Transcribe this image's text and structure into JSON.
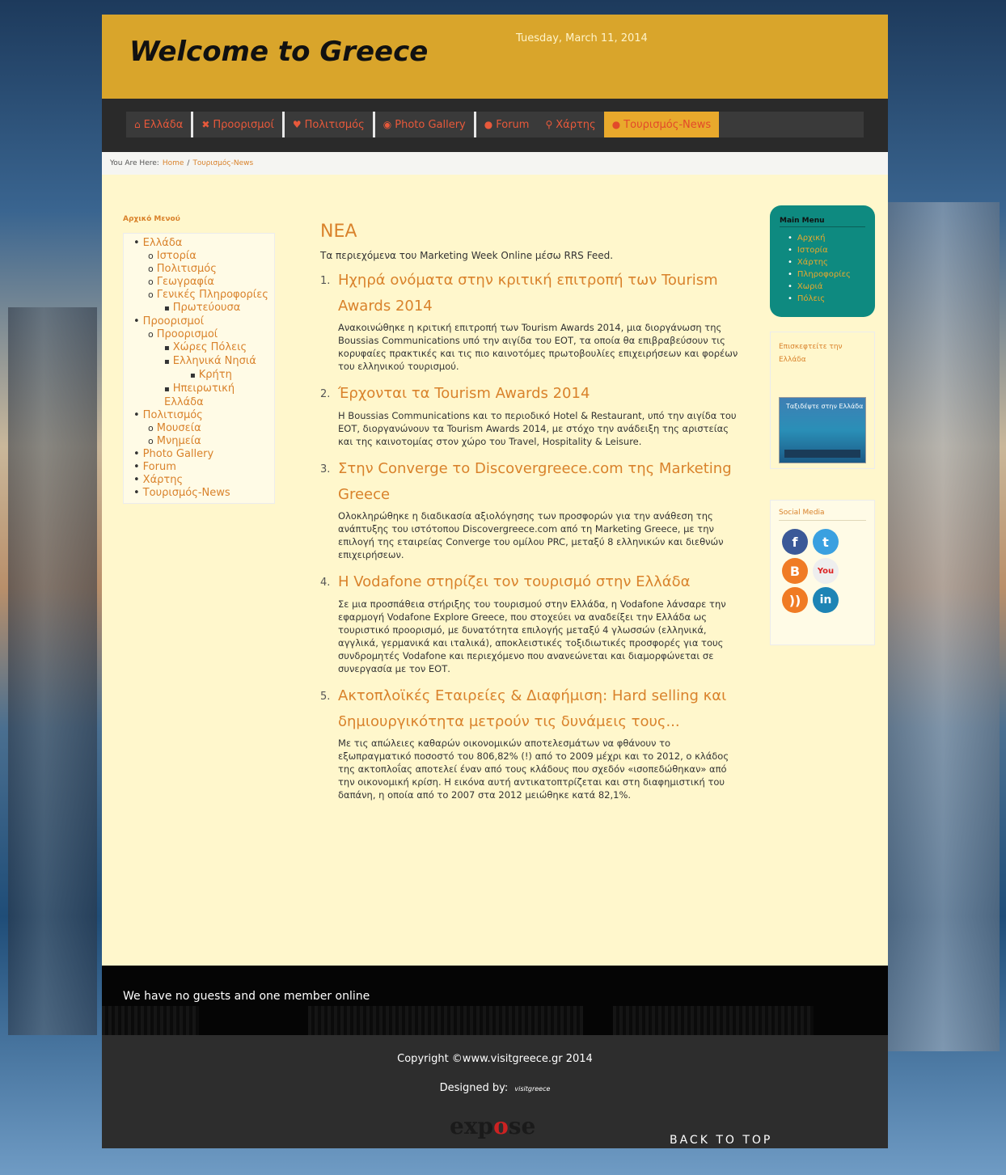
{
  "header": {
    "title": "Welcome to Greece",
    "date": "Tuesday, March 11, 2014"
  },
  "nav": {
    "items": [
      {
        "icon": "home-icon",
        "glyph": "⌂",
        "label": "Ελλάδα"
      },
      {
        "icon": "cross-icon",
        "glyph": "✖",
        "label": "Προορισμοί"
      },
      {
        "icon": "heart-icon",
        "glyph": "♥",
        "label": "Πολιτισμός"
      },
      {
        "icon": "camera-icon",
        "glyph": "◉",
        "label": "Photo Gallery"
      },
      {
        "icon": "comment-icon",
        "glyph": "●",
        "label": "Forum"
      },
      {
        "icon": "map-marker-icon",
        "glyph": "⚲",
        "label": "Χάρτης"
      },
      {
        "icon": "globe-icon",
        "glyph": "●",
        "label": "Τουρισμός-News"
      }
    ]
  },
  "breadcrumb": {
    "prefix": "You Are Here:",
    "home": "Home",
    "current": "Τουρισμός-News"
  },
  "left_menu": {
    "title": "Αρχικό Μενού",
    "items": [
      {
        "label": "Ελλάδα",
        "level": 0
      },
      {
        "label": "Ιστορία",
        "level": 1
      },
      {
        "label": "Πολιτισμός",
        "level": 1
      },
      {
        "label": "Γεωγραφία",
        "level": 1
      },
      {
        "label": "Γενικές Πληροφορίες",
        "level": 1
      },
      {
        "label": "Πρωτεύουσα",
        "level": 2
      },
      {
        "label": "Προορισμοί",
        "level": 0
      },
      {
        "label": "Προορισμοί",
        "level": 1
      },
      {
        "label": "Χώρες Πόλεις",
        "level": 2
      },
      {
        "label": "Ελληνικά Νησιά",
        "level": 2
      },
      {
        "label": "Κρήτη",
        "level": 3
      },
      {
        "label": "Ηπειρωτική Ελλάδα",
        "level": 2
      },
      {
        "label": "Πολιτισμός",
        "level": 0
      },
      {
        "label": "Μουσεία",
        "level": 1
      },
      {
        "label": "Μνημεία",
        "level": 1
      },
      {
        "label": "Photo Gallery",
        "level": 0
      },
      {
        "label": "Forum",
        "level": 0
      },
      {
        "label": "Χάρτης",
        "level": 0
      },
      {
        "label": "Τουρισμός-News",
        "level": 0
      }
    ]
  },
  "main": {
    "heading": "ΝΕΑ",
    "intro": "Τα περιεχόμενα του Marketing Week Online μέσω RRS Feed.",
    "news": [
      {
        "num": "1.",
        "title": "Ηχηρά ονόματα στην κριτική επιτροπή των Tourism Awards 2014",
        "body": "Ανακοινώθηκε η κριτική επιτροπή των Tourism Awards 2014, μια διοργάνωση της Boussias Communications υπό την αιγίδα του ΕΟΤ, τα οποία θα επιβραβεύσουν τις κορυφαίες πρακτικές και τις πιο καινοτόμες πρωτοβουλίες επιχειρήσεων και φορέων του ελληνικού τουρισμού."
      },
      {
        "num": "2.",
        "title": "Έρχονται τα Tourism Awards 2014",
        "body": "Η Boussias Communications και το περιοδικό Hotel & Restaurant, υπό την αιγίδα του ΕΟΤ, διοργανώνουν τα Tourism Awards 2014, με στόχο την ανάδειξη της αριστείας και της καινοτομίας στον χώρο του Travel, Hospitality & Leisure."
      },
      {
        "num": "3.",
        "title": "Στην Converge το Discovergreece.com της Marketing Greece",
        "body": "Ολοκληρώθηκε η διαδικασία αξιολόγησης των προσφορών για την ανάθεση της ανάπτυξης του ιστότοπου Discovergreece.com από τη Marketing Greece, με την επιλογή της εταιρείας Converge του ομίλου PRC, μεταξύ 8 ελληνικών και διεθνών επιχειρήσεων."
      },
      {
        "num": "4.",
        "title": "Η Vodafone στηρίζει τον τουρισμό στην Ελλάδα",
        "body": "Σε μια προσπάθεια στήριξης του τουρισμού στην Ελλάδα, η Vodafone λάνσαρε την εφαρμογή Vodafone Explore Greece, που στοχεύει να αναδείξει την Ελλάδα ως τουριστικό προορισμό, με δυνατότητα επιλογής μεταξύ 4 γλωσσών (ελληνικά, αγγλικά, γερμανικά και ιταλικά), αποκλειστικές τοξιδιωτικές προσφορές για τους συνδρομητές Vodafone και περιεχόμενο που ανανεώνεται και διαμορφώνεται σε συνεργασία με τον ΕΟΤ."
      },
      {
        "num": "5.",
        "title": "Ακτοπλοϊκές Εταιρείες & Διαφήμιση: Hard selling και δημιουργικότητα μετρούν τις δυνάμεις τους...",
        "body": "Με τις απώλειες καθαρών οικονομικών αποτελεσμάτων να φθάνουν το εξωπραγματικό ποσοστό του 806,82% (!) από το 2009 μέχρι και το 2012, ο κλάδος της ακτοπλοΐας αποτελεί έναν από τους κλάδους που σχεδόν «ισοπεδώθηκαν» από την οικονομική κρίση. Η εικόνα αυτή αντικατοπτρίζεται και στη διαφημιστική του δαπάνη, η οποία από το 2007 στα 2012 μειώθηκε κατά 82,1%."
      }
    ]
  },
  "right": {
    "main_menu_title": "Main Menu",
    "main_menu_items": [
      "Αρχική",
      "Ιστορία",
      "Χάρτης",
      "Πληροφορίες",
      "Χωριά",
      "Πόλεις"
    ],
    "video_title": "Επισκεφτείτε την Ελλάδα",
    "video_caption": "Ταξιδέψτε στην Ελλάδα",
    "social_title": "Social Media",
    "social_icons": [
      {
        "name": "facebook-icon",
        "glyph": "f"
      },
      {
        "name": "twitter-icon",
        "glyph": "t"
      },
      {
        "name": "blogger-icon",
        "glyph": "B"
      },
      {
        "name": "youtube-icon",
        "glyph": "You"
      },
      {
        "name": "rss-icon",
        "glyph": "))"
      },
      {
        "name": "linkedin-icon",
        "glyph": "in"
      }
    ]
  },
  "footer": {
    "online": "We have no guests and one member online",
    "copyright": "Copyright ©www.visitgreece.gr 2014",
    "designed_label": "Designed by:",
    "designed_brand": "visitgreece",
    "logo_a": "exp",
    "logo_o": "o",
    "logo_b": "se",
    "back_to_top": "BACK TO TOP"
  }
}
